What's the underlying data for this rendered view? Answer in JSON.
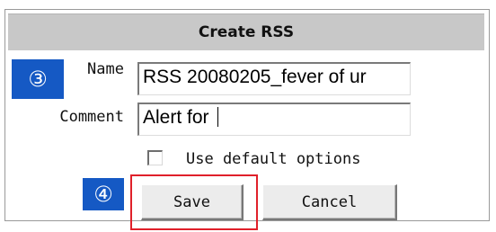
{
  "dialog": {
    "title": "Create RSS",
    "fields": {
      "name_label": "Name",
      "name_value": "RSS 20080205_fever of ur",
      "comment_label": "Comment",
      "comment_value": "Alert for "
    },
    "options": {
      "use_default_label": "Use default options",
      "use_default_checked": false
    },
    "buttons": {
      "save_label": "Save",
      "cancel_label": "Cancel"
    }
  },
  "annotations": {
    "step_3": "③",
    "step_4": "④",
    "badge_color": "#1559c4",
    "highlight_color": "#e0202a"
  }
}
